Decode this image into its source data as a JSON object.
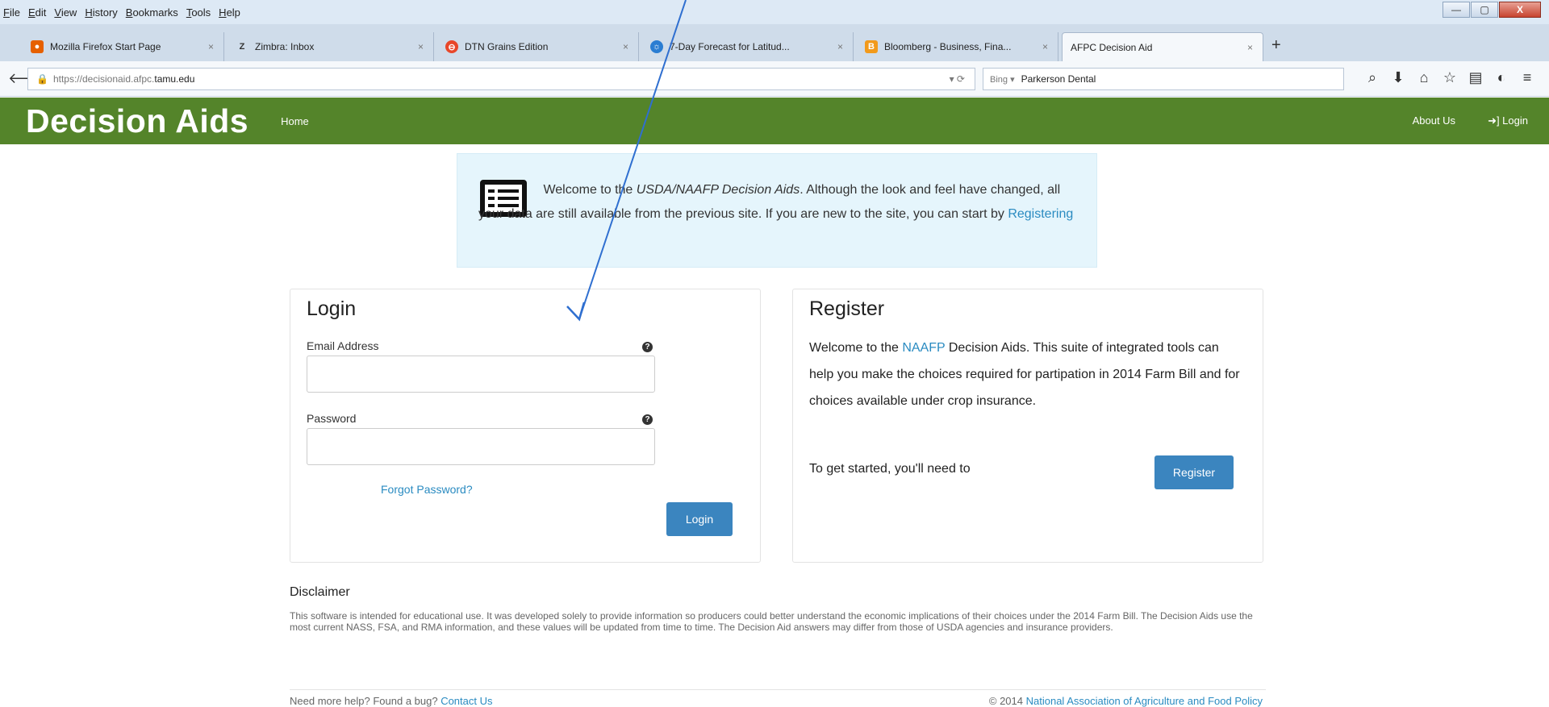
{
  "browser": {
    "menu": [
      "File",
      "Edit",
      "View",
      "History",
      "Bookmarks",
      "Tools",
      "Help"
    ],
    "window_controls": {
      "minimize": "—",
      "maximize": "▢",
      "close": "X"
    },
    "tabs": [
      {
        "label": "Mozilla Firefox Start Page",
        "icon": "firefox-icon",
        "color": "#e66000",
        "glyph": "●"
      },
      {
        "label": "Zimbra: Inbox",
        "icon": "zimbra-icon",
        "color": "#5b6b7b",
        "glyph": "Z"
      },
      {
        "label": "DTN Grains Edition",
        "icon": "dtn-icon",
        "color": "#e8472a",
        "glyph": "⊖"
      },
      {
        "label": "7-Day Forecast for Latitud...",
        "icon": "weather-icon",
        "color": "#2a7dd2",
        "glyph": "☼"
      },
      {
        "label": "Bloomberg - Business, Fina...",
        "icon": "bloomberg-icon",
        "color": "#f29a1b",
        "glyph": "B"
      },
      {
        "label": "AFPC Decision Aid",
        "icon": "none",
        "active": true
      }
    ],
    "new_tab": "+",
    "tab_close": "×",
    "url": {
      "prefix": "https://decisionaid.afpc.",
      "host": "tamu.edu"
    },
    "search": {
      "engine": "Bing ▾",
      "value": "Parkerson Dental"
    },
    "toolbar_icons": [
      "search-glass-icon",
      "download-icon",
      "home-icon",
      "bookmark-star-icon",
      "reading-list-icon",
      "addon-icon",
      "menu-icon"
    ]
  },
  "site": {
    "brand": "Decision Aids",
    "nav_home": "Home",
    "nav_about": "About Us",
    "nav_login": "➜] Login"
  },
  "alert": {
    "text_before": "Welcome to the ",
    "text_italic": "USDA/NAAFP Decision Aids",
    "text_after": ". Although the look and feel have changed, all your data are still available from the previous site. If you are new to the site, you can start by ",
    "link": "Registering"
  },
  "login": {
    "title": "Login",
    "email_label": "Email Address",
    "email_value": "",
    "password_label": "Password",
    "password_value": "",
    "help_glyph": "?",
    "forgot": "Forgot Password?",
    "button": "Login"
  },
  "register": {
    "title": "Register",
    "intro_before": "Welcome to the ",
    "intro_link": "NAAFP",
    "intro_after": " Decision Aids. This suite of integrated tools can help you make the choices required for partipation in 2014 Farm Bill and for choices available under crop insurance.",
    "started": "To get started, you'll need to",
    "button": "Register"
  },
  "disclaimer": {
    "title": "Disclaimer",
    "body": "This software is intended for educational use. It was developed solely to provide information so producers could better understand the economic implications of their choices under the 2014 Farm Bill. The Decision Aids use the most current NASS, FSA, and RMA information, and these values will be updated from time to time. The Decision Aid answers may differ from those of USDA agencies and insurance providers."
  },
  "footer": {
    "help_text": "Need more help? Found a bug? ",
    "contact_link": "Contact Us",
    "copyright": "© 2014 ",
    "org_link": "National Association of Agriculture and Food Policy"
  },
  "colors": {
    "header_green": "#54842a",
    "link_blue": "#2a8bc1",
    "button_blue": "#3b85bf",
    "alert_bg": "#e5f5fc",
    "arrow_blue": "#2f6fd0"
  }
}
